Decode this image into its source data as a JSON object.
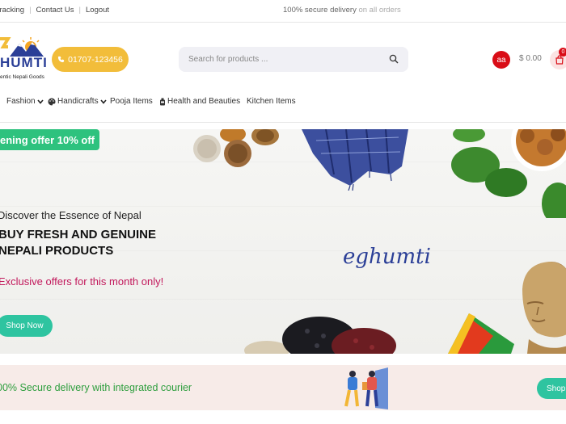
{
  "topbar": {
    "links": [
      "Tracking",
      "Contact Us",
      "Logout"
    ],
    "notice_main": "100% secure delivery",
    "notice_rest": "on all orders"
  },
  "header": {
    "logo_text": "HUMTI",
    "logo_tagline": "entic Nepali Goods",
    "phone": "01707-123456",
    "search_placeholder": "Search for products ...",
    "avatar_initials": "aa",
    "cart_total": "$ 0.00",
    "cart_count": "0"
  },
  "nav": {
    "items": [
      {
        "label": "Fashion",
        "has_dropdown": true
      },
      {
        "label": "Handicrafts",
        "has_dropdown": true
      },
      {
        "label": "Pooja Items",
        "has_dropdown": false
      },
      {
        "label": "Health and Beauties",
        "has_dropdown": false
      },
      {
        "label": "Kitchen Items",
        "has_dropdown": false
      }
    ]
  },
  "hero": {
    "offer_tag": "ening offer 10% off",
    "subtitle": "Discover the Essence of Nepal",
    "title_line1": "BUY FRESH AND GENUINE",
    "title_line2": "NEPALI PRODUCTS",
    "offer_text": "Exclusive offers for this month only!",
    "cta": "Shop Now",
    "brand": "eghumti"
  },
  "band": {
    "text": "00% Secure delivery with integrated courier",
    "cta": "Shop"
  },
  "colors": {
    "accent_green": "#2ec4a0",
    "offer_green": "#2ec27e",
    "phone_yellow": "#f2bd3a",
    "brand_red": "#d90d17",
    "brand_blue": "#2b3f97",
    "offer_pink": "#c2185b"
  }
}
